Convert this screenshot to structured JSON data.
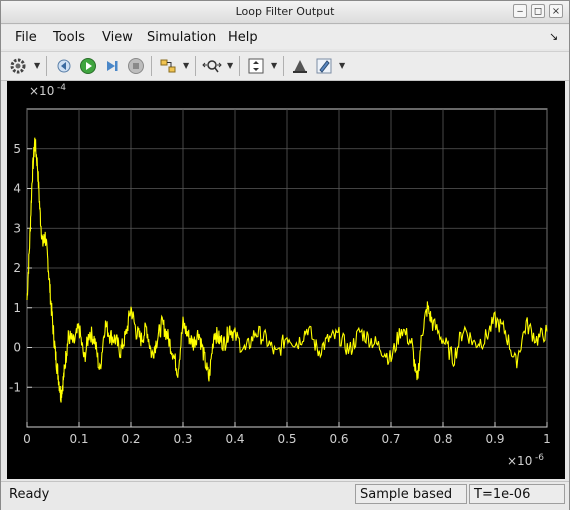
{
  "window": {
    "title": "Loop Filter Output"
  },
  "menu": {
    "file": "File",
    "tools": "Tools",
    "view": "View",
    "simulation": "Simulation",
    "help": "Help"
  },
  "toolbar": {
    "icons": [
      "gear-icon",
      "back-step-icon",
      "run-icon",
      "step-forward-icon",
      "stop-icon",
      "signal-icon",
      "zoom-icon",
      "autoscale-icon",
      "highlight-icon",
      "edit-icon"
    ]
  },
  "status": {
    "text": "Ready",
    "mode": "Sample based",
    "time": "T=1e-06"
  },
  "chart_data": {
    "type": "line",
    "series": [
      {
        "color": "#ffff00",
        "x": [
          0,
          0.005,
          0.01,
          0.015,
          0.02,
          0.025,
          0.03,
          0.035,
          0.04,
          0.045,
          0.05,
          0.055,
          0.06,
          0.065,
          0.07,
          0.075,
          0.08,
          0.09,
          0.1,
          0.11,
          0.12,
          0.13,
          0.14,
          0.15,
          0.16,
          0.17,
          0.18,
          0.19,
          0.2,
          0.21,
          0.22,
          0.23,
          0.24,
          0.25,
          0.26,
          0.27,
          0.28,
          0.29,
          0.3,
          0.31,
          0.32,
          0.33,
          0.34,
          0.35,
          0.36,
          0.37,
          0.38,
          0.39,
          0.4,
          0.42,
          0.44,
          0.46,
          0.48,
          0.5,
          0.52,
          0.54,
          0.56,
          0.58,
          0.6,
          0.62,
          0.64,
          0.66,
          0.68,
          0.7,
          0.72,
          0.74,
          0.75,
          0.76,
          0.77,
          0.78,
          0.8,
          0.82,
          0.84,
          0.86,
          0.88,
          0.9,
          0.92,
          0.94,
          0.96,
          0.98,
          1.0
        ],
        "y": [
          1.2,
          2.6,
          4.3,
          5.2,
          4.6,
          3.4,
          2.6,
          2.8,
          2.2,
          1.3,
          0.5,
          -0.2,
          -0.7,
          -1.2,
          -0.8,
          -0.2,
          0.3,
          0.1,
          0.5,
          -0.3,
          0.4,
          0.2,
          -0.6,
          0.6,
          0.3,
          0.2,
          -0.1,
          0.3,
          1.0,
          0.4,
          0.2,
          0.5,
          -0.2,
          0.2,
          0.6,
          0.3,
          -0.1,
          -0.6,
          0.6,
          0.3,
          0.1,
          0.4,
          -0.2,
          -0.8,
          0.4,
          0.2,
          0.1,
          0.5,
          0.3,
          -0.1,
          0.4,
          0.2,
          -0.2,
          0.3,
          0.1,
          0.5,
          -0.1,
          0.2,
          0.3,
          -0.1,
          0.4,
          0.2,
          0.0,
          -0.3,
          0.5,
          0.1,
          -0.9,
          0.4,
          1.0,
          0.6,
          0.2,
          -0.3,
          0.5,
          0.1,
          0.2,
          0.7,
          0.4,
          -0.4,
          0.6,
          0.2,
          0.4
        ]
      }
    ],
    "xlim": [
      0,
      1
    ],
    "ylim": [
      -2,
      6
    ],
    "xticks": [
      "0",
      "0.1",
      "0.2",
      "0.3",
      "0.4",
      "0.5",
      "0.6",
      "0.7",
      "0.8",
      "0.9",
      "1"
    ],
    "yticks": [
      "-1",
      "0",
      "1",
      "2",
      "3",
      "4",
      "5"
    ],
    "xticks_values": [
      0,
      0.1,
      0.2,
      0.3,
      0.4,
      0.5,
      0.6,
      0.7,
      0.8,
      0.9,
      1
    ],
    "yticks_values": [
      -1,
      0,
      1,
      2,
      3,
      4,
      5
    ],
    "yexp_base": "×10",
    "yexp": "-4",
    "xexp_base": "×10",
    "xexp": "-6",
    "grid": true,
    "background": "#000000",
    "axes_color": "#cfcfcf"
  }
}
